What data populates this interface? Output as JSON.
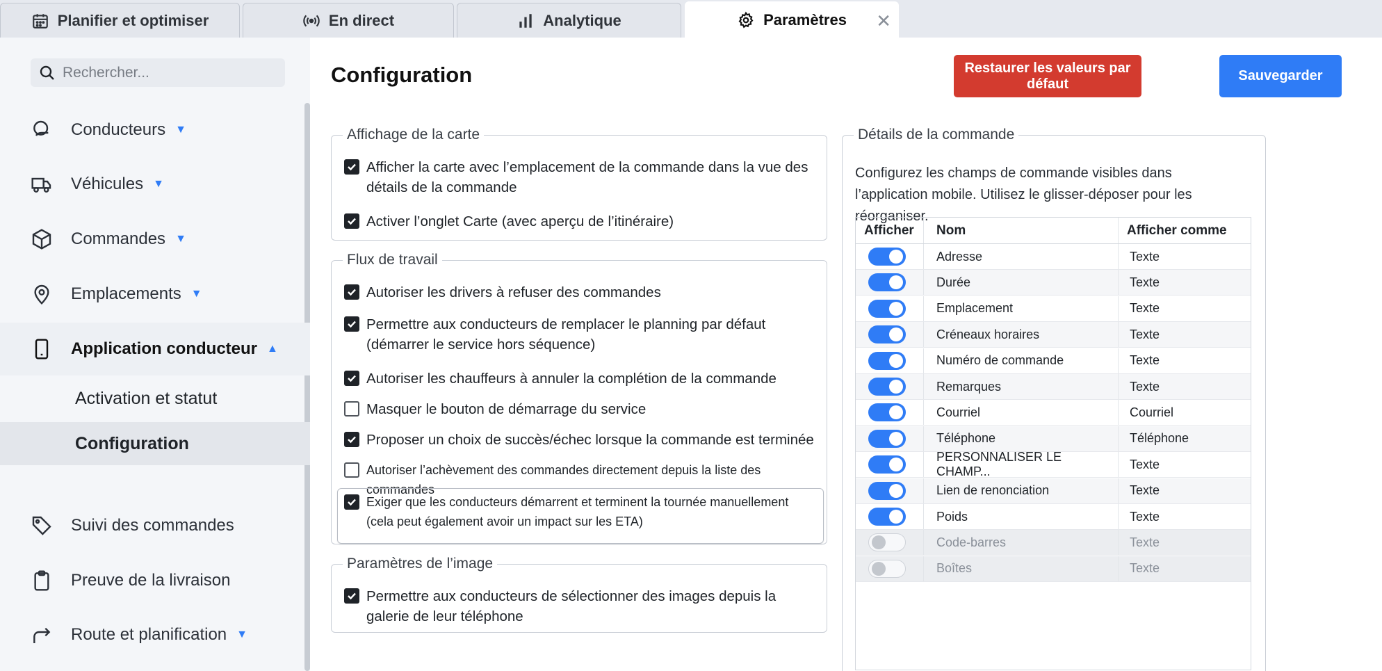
{
  "tabs": [
    {
      "label": "Planifier et optimiser",
      "icon": "calendar-icon"
    },
    {
      "label": "En direct",
      "icon": "broadcast-icon"
    },
    {
      "label": "Analytique",
      "icon": "bar-chart-icon"
    },
    {
      "label": "Paramètres",
      "icon": "gear-icon",
      "active": true
    }
  ],
  "sidebar": {
    "search_placeholder": "Rechercher...",
    "items": [
      {
        "label": "Conducteurs",
        "icon": "driver-icon",
        "expandable": true
      },
      {
        "label": "Véhicules",
        "icon": "truck-icon",
        "expandable": true
      },
      {
        "label": "Commandes",
        "icon": "box-icon",
        "expandable": true
      },
      {
        "label": "Emplacements",
        "icon": "location-pin-icon",
        "expandable": true
      },
      {
        "label": "Application conducteur",
        "icon": "phone-icon",
        "expanded": true
      },
      {
        "label": "Suivi des commandes",
        "icon": "tag-icon"
      },
      {
        "label": "Preuve de la livraison",
        "icon": "clipboard-icon"
      },
      {
        "label": "Route et planification",
        "icon": "route-arrow-icon",
        "expandable": true
      }
    ],
    "sub_items": [
      {
        "label": "Activation et statut"
      },
      {
        "label": "Configuration",
        "selected": true
      }
    ]
  },
  "main": {
    "title": "Configuration",
    "reset_label": "Restaurer les valeurs par défaut",
    "save_label": "Sauvegarder",
    "map_display": {
      "legend": "Affichage de la carte",
      "options": [
        {
          "label": "Afficher la carte avec l’emplacement de la commande dans la vue des détails de la commande",
          "checked": true
        },
        {
          "label": "Activer l’onglet Carte (avec aperçu de l’itinéraire)",
          "checked": true
        }
      ]
    },
    "workflow": {
      "legend": "Flux de travail",
      "options": [
        {
          "label": "Autoriser les drivers à refuser des commandes",
          "checked": true
        },
        {
          "label": "Permettre aux conducteurs de remplacer le planning par défaut (démarrer le service hors séquence)",
          "checked": true
        },
        {
          "label": "Autoriser les chauffeurs à annuler la complétion de la commande",
          "checked": true
        },
        {
          "label": "Masquer le bouton de démarrage du service",
          "checked": false
        },
        {
          "label": "Proposer un choix de succès/échec lorsque la commande est terminée",
          "checked": true
        },
        {
          "label": "Autoriser l’achèvement des commandes directement depuis la liste des commandes",
          "checked": false
        },
        {
          "label": "Exiger que les conducteurs démarrent et terminent la tournée manuellement (cela peut également avoir un impact sur les ETA)",
          "checked": true
        }
      ]
    },
    "image_settings": {
      "legend": "Paramètres de l’image",
      "options": [
        {
          "label": "Permettre aux conducteurs de sélectionner des images depuis la galerie de leur téléphone",
          "checked": true
        }
      ]
    },
    "order_details": {
      "legend": "Détails de la commande",
      "description": "Configurez les champs de commande visibles dans l’application mobile. Utilisez le glisser-déposer pour les réorganiser.",
      "columns": [
        "Afficher",
        "Nom",
        "Afficher comme"
      ],
      "rows": [
        {
          "show": true,
          "name": "Adresse",
          "display": "Texte"
        },
        {
          "show": true,
          "name": "Durée",
          "display": "Texte"
        },
        {
          "show": true,
          "name": "Emplacement",
          "display": "Texte"
        },
        {
          "show": true,
          "name": "Créneaux horaires",
          "display": "Texte"
        },
        {
          "show": true,
          "name": "Numéro de commande",
          "display": "Texte"
        },
        {
          "show": true,
          "name": "Remarques",
          "display": "Texte"
        },
        {
          "show": true,
          "name": "Courriel",
          "display": "Courriel"
        },
        {
          "show": true,
          "name": "Téléphone",
          "display": "Téléphone"
        },
        {
          "show": true,
          "name": "PERSONNALISER LE CHAMP...",
          "display": "Texte"
        },
        {
          "show": true,
          "name": "Lien de renonciation",
          "display": "Texte"
        },
        {
          "show": true,
          "name": "Poids",
          "display": "Texte"
        },
        {
          "show": false,
          "name": "Code-barres",
          "display": "Texte"
        },
        {
          "show": false,
          "name": "Boîtes",
          "display": "Texte"
        }
      ]
    }
  },
  "colors": {
    "accent": "#2f7cf6",
    "danger": "#d33b2f"
  }
}
